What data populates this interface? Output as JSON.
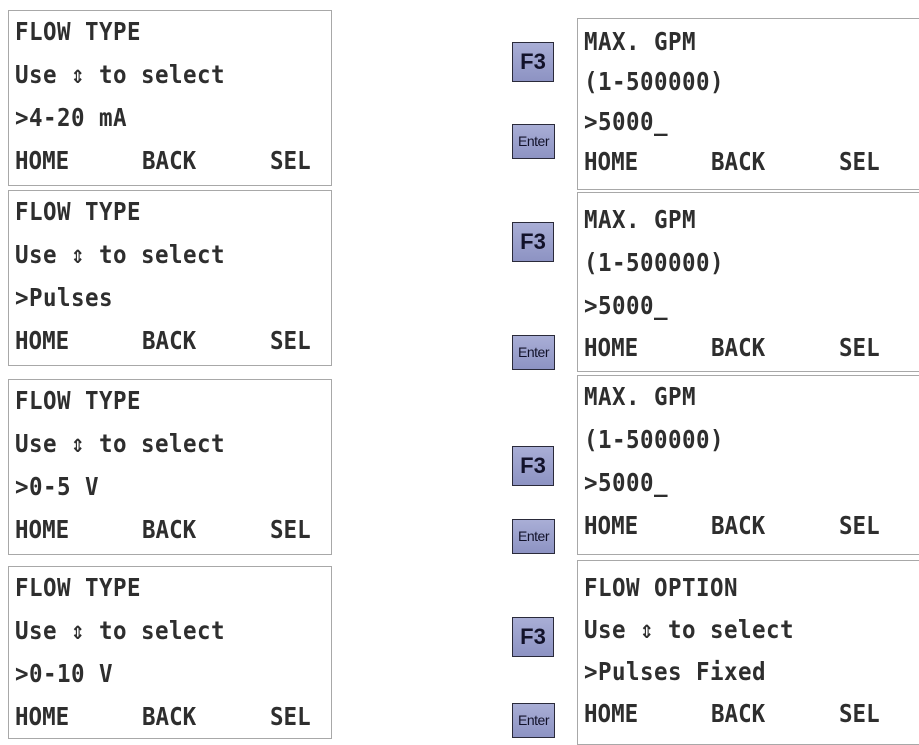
{
  "left_screens": [
    {
      "title": "FLOW TYPE",
      "prompt": "Use ⇕ to select",
      "value": ">4-20 mA"
    },
    {
      "title": "FLOW TYPE",
      "prompt": "Use ⇕ to select",
      "value": ">Pulses"
    },
    {
      "title": "FLOW TYPE",
      "prompt": "Use ⇕ to select",
      "value": ">0-5 V"
    },
    {
      "title": "FLOW TYPE",
      "prompt": "Use ⇕ to select",
      "value": ">0-10 V"
    }
  ],
  "right_screens": [
    {
      "line1": "MAX. GPM",
      "line2": "(1-500000)",
      "line3": ">5000_"
    },
    {
      "line1": "MAX. GPM",
      "line2": "(1-500000)",
      "line3": ">5000_"
    },
    {
      "line1": "MAX. GPM",
      "line2": "(1-500000)",
      "line3": ">5000_"
    },
    {
      "line1": "FLOW OPTION",
      "line2": "Use ⇕ to select",
      "line3": ">Pulses Fixed"
    }
  ],
  "softkeys": {
    "home": "HOME",
    "back": "BACK",
    "sel": "SEL"
  },
  "keys": {
    "f3": "F3",
    "enter": "Enter"
  },
  "colors": {
    "key_fill": "#9da2cf",
    "lcd_text": "#2e2e2e",
    "screen_border": "#a8a8a8"
  }
}
